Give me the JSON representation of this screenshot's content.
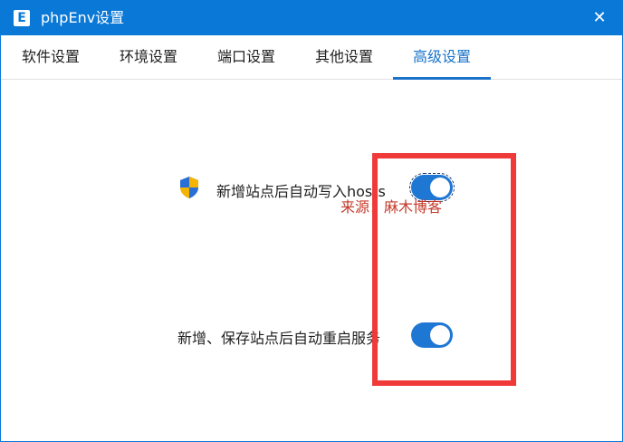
{
  "window": {
    "title": "phpEnv设置",
    "app_icon_letter": "E",
    "close_glyph": "✕"
  },
  "tabs": [
    {
      "label": "软件设置",
      "active": false
    },
    {
      "label": "环境设置",
      "active": false
    },
    {
      "label": "端口设置",
      "active": false
    },
    {
      "label": "其他设置",
      "active": false
    },
    {
      "label": "高级设置",
      "active": true
    }
  ],
  "settings": [
    {
      "label": "新增站点后自动写入hosts",
      "enabled": true,
      "icon": "uac-shield-icon"
    },
    {
      "label": "新增、保存站点后自动重启服务",
      "enabled": true
    }
  ],
  "watermark": "来源：麻木博客",
  "colors": {
    "titlebar": "#0a78d7",
    "accent": "#1a73c9",
    "toggle_on": "#1f77d4",
    "highlight_box": "#f03a3a",
    "watermark": "#c43a2a"
  }
}
